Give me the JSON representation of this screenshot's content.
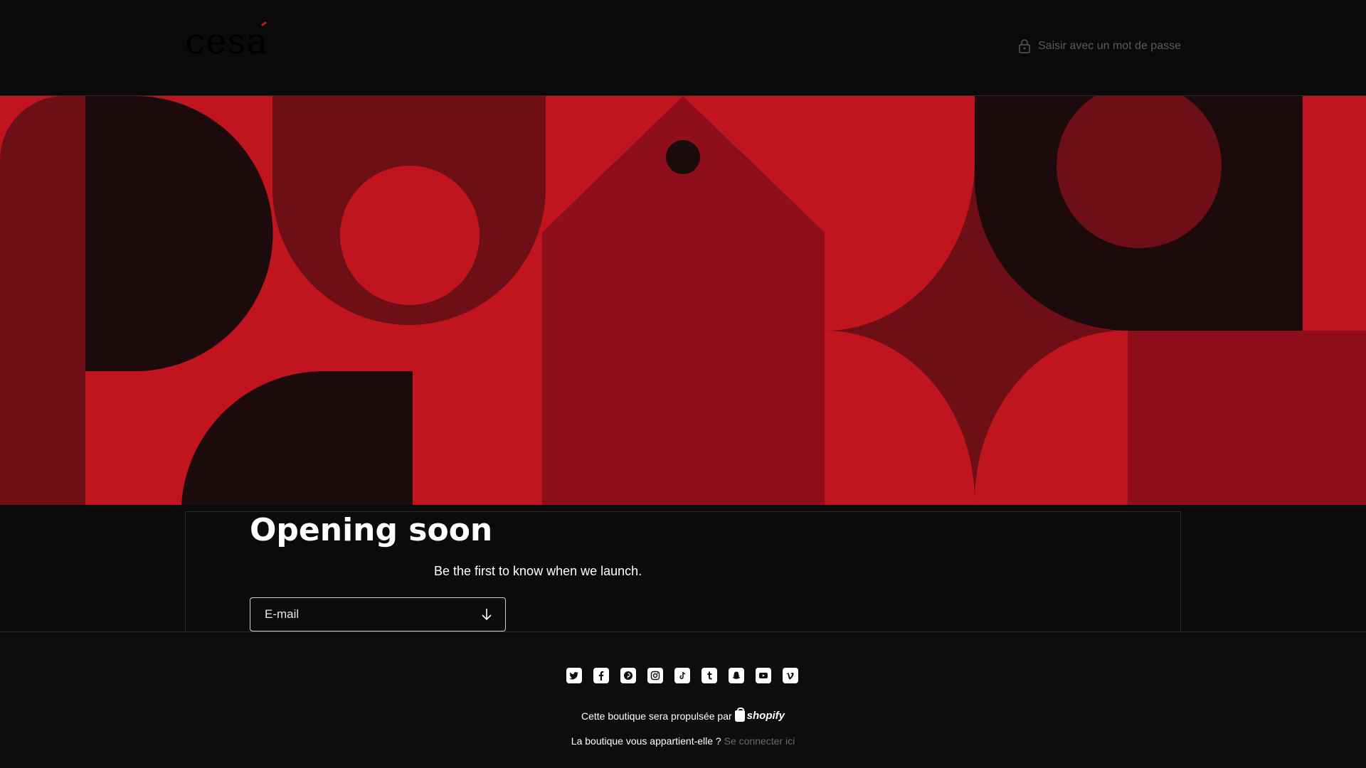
{
  "header": {
    "logo_text": "cesa",
    "password_link": "Saisir avec un mot de passe"
  },
  "hero": {
    "title": "Opening soon",
    "subtitle": "Be the first to know when we launch."
  },
  "form": {
    "email_placeholder": "E-mail"
  },
  "footer": {
    "socials": [
      {
        "name": "twitter-icon"
      },
      {
        "name": "facebook-icon"
      },
      {
        "name": "pinterest-icon"
      },
      {
        "name": "instagram-icon"
      },
      {
        "name": "tiktok-icon"
      },
      {
        "name": "tumblr-icon"
      },
      {
        "name": "snapchat-icon"
      },
      {
        "name": "youtube-icon"
      },
      {
        "name": "vimeo-icon"
      }
    ],
    "powered_text": "Cette boutique sera propulsée par",
    "powered_brand": "shopify",
    "owner_text": "La boutique vous appartient-elle ?",
    "login_link": "Se connecter ici"
  },
  "colors": {
    "background": "#0b0b0b",
    "red": "#c0141f",
    "dark_red": "#6e0e17",
    "mid_red": "#8e0f1b",
    "darkest": "#1c0a0c",
    "link_grey": "#6a6a6a"
  }
}
